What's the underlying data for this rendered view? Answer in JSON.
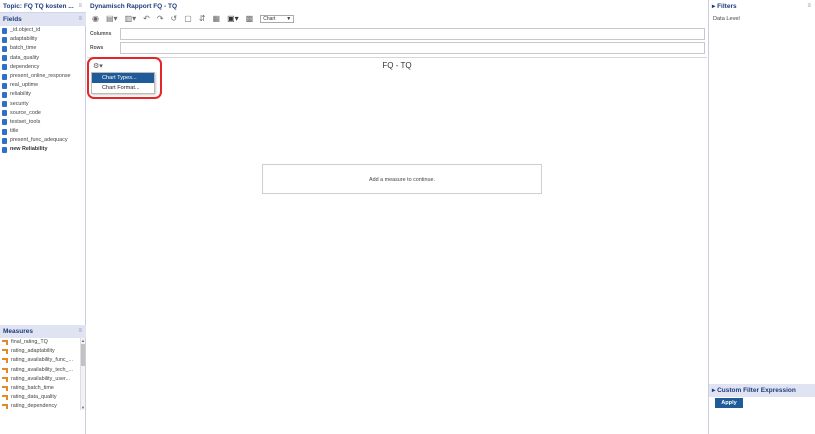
{
  "left": {
    "topic_title": "Topic: FQ TQ kosten ...",
    "fields_header": "Fields",
    "fields": [
      {
        "label": "_id.object_id",
        "bold": false
      },
      {
        "label": "adaptability",
        "bold": false
      },
      {
        "label": "batch_time",
        "bold": false
      },
      {
        "label": "data_quality",
        "bold": false
      },
      {
        "label": "dependency",
        "bold": false
      },
      {
        "label": "present_online_response",
        "bold": false
      },
      {
        "label": "real_uptime",
        "bold": false
      },
      {
        "label": "reliability",
        "bold": false
      },
      {
        "label": "security",
        "bold": false
      },
      {
        "label": "source_code",
        "bold": false
      },
      {
        "label": "testset_tools",
        "bold": false
      },
      {
        "label": "title",
        "bold": false
      },
      {
        "label": "present_func_adequacy",
        "bold": false
      },
      {
        "label": "new Reliability",
        "bold": true
      }
    ],
    "measures_header": "Measures",
    "measures": [
      "final_rating_TQ",
      "rating_adaptability",
      "rating_availability_func_...",
      "rating_availability_tech_...",
      "rating_availability_user...",
      "rating_batch_time",
      "rating_data_quality",
      "rating_dependency"
    ]
  },
  "center": {
    "report_title": "Dynamisch Rapport FQ - TQ",
    "chart_select_value": "Chart",
    "columns_label": "Columns",
    "rows_label": "Rows",
    "chart_title": "FQ - TQ",
    "menu_items": [
      "Chart Types...",
      "Chart Format..."
    ],
    "placeholder_text": "Add a measure to continue."
  },
  "right": {
    "filters_header": "Filters",
    "data_level": "Data Level",
    "custom_filter_header": "Custom Filter Expression",
    "apply_label": "Apply"
  },
  "colors": {
    "accent": "#1f5a99",
    "highlight": "#e4252a",
    "header_bg": "#dfe3f2"
  }
}
